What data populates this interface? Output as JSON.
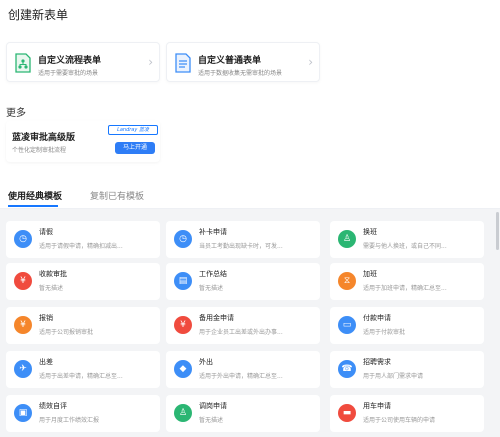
{
  "header": {
    "title": "创建新表单"
  },
  "top_cards": [
    {
      "title": "自定义流程表单",
      "desc": "适用于需要审批的场景",
      "icon": "flow-form-icon"
    },
    {
      "title": "自定义普通表单",
      "desc": "适用于数据收集无需审批的场景",
      "icon": "document-form-icon"
    }
  ],
  "more": {
    "label": "更多",
    "promo": {
      "title": "蓝凌审批高级版",
      "desc": "个性化定制审批流程",
      "logo_text": "Landray 蓝凌",
      "button": "马上开通"
    }
  },
  "tabs": [
    {
      "label": "使用经典模板",
      "active": true
    },
    {
      "label": "复制已有模板",
      "active": false
    }
  ],
  "templates": [
    {
      "name": "请假",
      "desc": "适用于请假申请，精确扣减出...",
      "color": "#3d8ef7",
      "icon": "clock-icon",
      "glyph": "◷"
    },
    {
      "name": "补卡申请",
      "desc": "当员工考勤出现缺卡时，可发...",
      "color": "#3d8ef7",
      "icon": "clock-icon",
      "glyph": "◷"
    },
    {
      "name": "换班",
      "desc": "需要与他人换班，或自己不同...",
      "color": "#2bb673",
      "icon": "person-icon",
      "glyph": "♙"
    },
    {
      "name": "收款审批",
      "desc": "暂无描述",
      "color": "#f04b3e",
      "icon": "money-icon",
      "glyph": "¥"
    },
    {
      "name": "工作总结",
      "desc": "暂无描述",
      "color": "#3d8ef7",
      "icon": "document-icon",
      "glyph": "▤"
    },
    {
      "name": "加班",
      "desc": "适用于加班申请，精确汇总至...",
      "color": "#f5862b",
      "icon": "overtime-icon",
      "glyph": "⧖"
    },
    {
      "name": "报销",
      "desc": "适用于公司报销审批",
      "color": "#f5862b",
      "icon": "reimburse-icon",
      "glyph": "¥"
    },
    {
      "name": "备用金申请",
      "desc": "用于企业员工出差或外出办事...",
      "color": "#f04b3e",
      "icon": "money-bag-icon",
      "glyph": "¥"
    },
    {
      "name": "付款申请",
      "desc": "适用于付款审批",
      "color": "#3d8ef7",
      "icon": "card-icon",
      "glyph": "▭"
    },
    {
      "name": "出差",
      "desc": "适用于出差申请，精确汇总至...",
      "color": "#3d8ef7",
      "icon": "airplane-icon",
      "glyph": "✈"
    },
    {
      "name": "外出",
      "desc": "适用于外出申请，精确汇总至...",
      "color": "#3d8ef7",
      "icon": "tag-icon",
      "glyph": "◆"
    },
    {
      "name": "招聘需求",
      "desc": "用于用人部门需求申请",
      "color": "#3d8ef7",
      "icon": "recruit-icon",
      "glyph": "☎"
    },
    {
      "name": "绩效自评",
      "desc": "用于月度工作绩效汇报",
      "color": "#3d8ef7",
      "icon": "evaluation-icon",
      "glyph": "▣"
    },
    {
      "name": "调岗申请",
      "desc": "暂无描述",
      "color": "#2bb673",
      "icon": "transfer-icon",
      "glyph": "♙"
    },
    {
      "name": "用车申请",
      "desc": "适用于公司使用车辆的申请",
      "color": "#f04b3e",
      "icon": "car-icon",
      "glyph": "▬"
    }
  ]
}
